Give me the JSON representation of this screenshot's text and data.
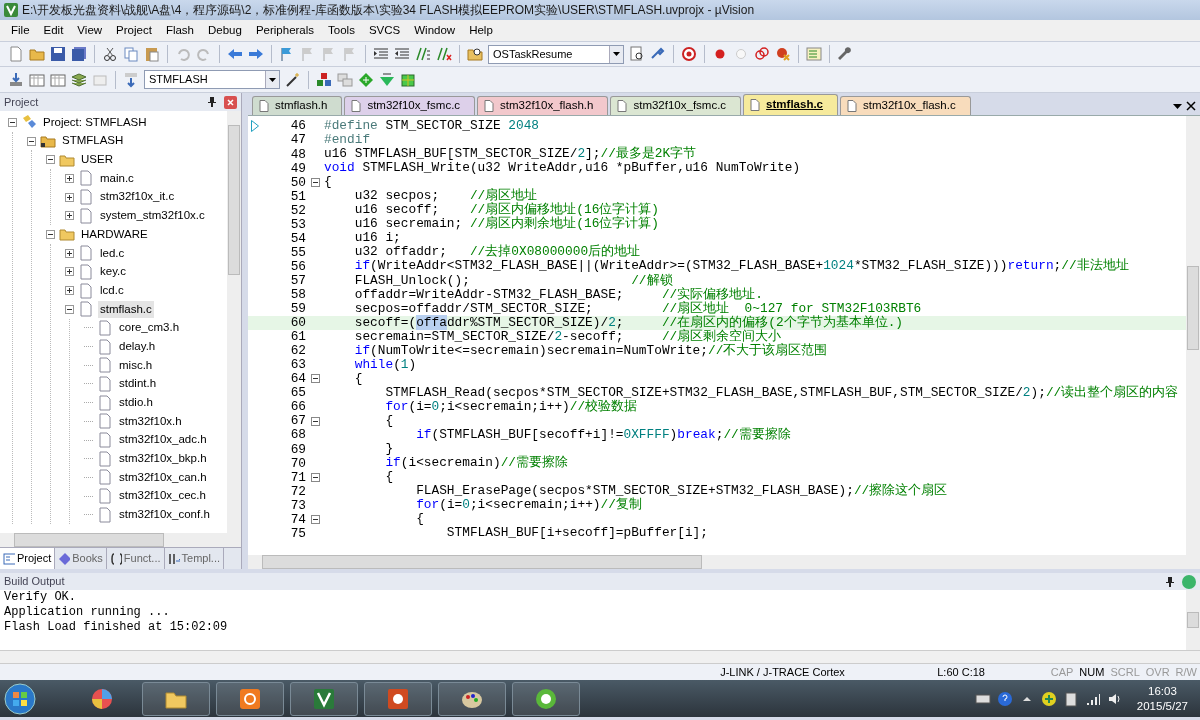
{
  "window": {
    "title": "E:\\开发板光盘资料\\战舰\\A盘\\4，程序源码\\2，标准例程-库函数版本\\实验34 FLASH模拟EEPROM实验\\USER\\STMFLASH.uvprojx - µVision"
  },
  "menu": [
    "File",
    "Edit",
    "View",
    "Project",
    "Flash",
    "Debug",
    "Peripherals",
    "Tools",
    "SVCS",
    "Window",
    "Help"
  ],
  "toolbar": {
    "function_combo": "OSTaskResume",
    "target_combo": "STMFLASH"
  },
  "project_panel": {
    "title": "Project",
    "tree": [
      {
        "label": "Project: STMFLASH",
        "kind": "project",
        "expanded": true,
        "selected": false,
        "children": [
          {
            "label": "STMFLASH",
            "kind": "group",
            "expanded": true,
            "selected": false,
            "children": [
              {
                "label": "USER",
                "kind": "folder",
                "expanded": true,
                "selected": false,
                "children": [
                  {
                    "label": "main.c",
                    "kind": "file",
                    "expanded": false,
                    "selected": false
                  },
                  {
                    "label": "stm32f10x_it.c",
                    "kind": "file",
                    "expanded": false,
                    "selected": false
                  },
                  {
                    "label": "system_stm32f10x.c",
                    "kind": "file",
                    "expanded": false,
                    "selected": false
                  }
                ]
              },
              {
                "label": "HARDWARE",
                "kind": "folder",
                "expanded": true,
                "selected": false,
                "children": [
                  {
                    "label": "led.c",
                    "kind": "file",
                    "expanded": false,
                    "selected": false
                  },
                  {
                    "label": "key.c",
                    "kind": "file",
                    "expanded": false,
                    "selected": false
                  },
                  {
                    "label": "lcd.c",
                    "kind": "file",
                    "expanded": false,
                    "selected": false
                  },
                  {
                    "label": "stmflash.c",
                    "kind": "file",
                    "expanded": true,
                    "selected": true,
                    "children": [
                      {
                        "label": "core_cm3.h",
                        "kind": "header",
                        "selected": false
                      },
                      {
                        "label": "delay.h",
                        "kind": "header",
                        "selected": false
                      },
                      {
                        "label": "misc.h",
                        "kind": "header",
                        "selected": false
                      },
                      {
                        "label": "stdint.h",
                        "kind": "header",
                        "selected": false
                      },
                      {
                        "label": "stdio.h",
                        "kind": "header",
                        "selected": false
                      },
                      {
                        "label": "stm32f10x.h",
                        "kind": "header",
                        "selected": false
                      },
                      {
                        "label": "stm32f10x_adc.h",
                        "kind": "header",
                        "selected": false
                      },
                      {
                        "label": "stm32f10x_bkp.h",
                        "kind": "header",
                        "selected": false
                      },
                      {
                        "label": "stm32f10x_can.h",
                        "kind": "header",
                        "selected": false
                      },
                      {
                        "label": "stm32f10x_cec.h",
                        "kind": "header",
                        "selected": false
                      },
                      {
                        "label": "stm32f10x_conf.h",
                        "kind": "header",
                        "selected": false
                      }
                    ]
                  }
                ]
              }
            ]
          }
        ]
      }
    ],
    "tabs": [
      {
        "label": "Project",
        "selected": true
      },
      {
        "label": "Books",
        "selected": false
      },
      {
        "label": "Funct...",
        "selected": false
      },
      {
        "label": "Templ...",
        "selected": false
      }
    ]
  },
  "editor": {
    "tabs": [
      {
        "label": "stmflash.h",
        "selected": false,
        "color": "#cfdccf"
      },
      {
        "label": "stm32f10x_fsmc.c",
        "selected": false,
        "color": "#ddd0ea"
      },
      {
        "label": "stm32f10x_flash.h",
        "selected": false,
        "color": "#f2c8cc"
      },
      {
        "label": "stm32f10x_fsmc.c",
        "selected": false,
        "color": "#dbe6d2"
      },
      {
        "label": "stmflash.c",
        "selected": true,
        "color": "#f6ea9c"
      },
      {
        "label": "stm32f10x_flash.c",
        "selected": false,
        "color": "#f8dcbc"
      }
    ],
    "lines": [
      {
        "number": "46",
        "fold_open": false,
        "marker": true,
        "current": false,
        "segments": [
          {
            "kind": "preproc",
            "text": "#define"
          },
          {
            "kind": "plain",
            "text": " STM_SECTOR_SIZE "
          },
          {
            "kind": "number",
            "text": "2048"
          }
        ]
      },
      {
        "number": "47",
        "fold_open": false,
        "marker": false,
        "current": false,
        "segments": [
          {
            "kind": "preproc",
            "text": "#endif"
          }
        ]
      },
      {
        "number": "48",
        "fold_open": false,
        "marker": false,
        "current": false,
        "segments": [
          {
            "kind": "plain",
            "text": "u16 STMFLASH_BUF[STM_SECTOR_SIZE/"
          },
          {
            "kind": "number",
            "text": "2"
          },
          {
            "kind": "plain",
            "text": "];"
          },
          {
            "kind": "comment",
            "text": "//最多是2K字节"
          }
        ]
      },
      {
        "number": "49",
        "fold_open": false,
        "marker": false,
        "current": false,
        "segments": [
          {
            "kind": "keyword",
            "text": "void"
          },
          {
            "kind": "plain",
            "text": " STMFLASH_Write(u32 WriteAddr,u16 *pBuffer,u16 NumToWrite)"
          }
        ]
      },
      {
        "number": "50",
        "fold_open": true,
        "marker": false,
        "current": false,
        "segments": [
          {
            "kind": "plain",
            "text": "{"
          }
        ]
      },
      {
        "number": "51",
        "fold_open": false,
        "marker": false,
        "current": false,
        "segments": [
          {
            "kind": "plain",
            "text": "    u32 secpos;    "
          },
          {
            "kind": "comment",
            "text": "//扇区地址"
          }
        ]
      },
      {
        "number": "52",
        "fold_open": false,
        "marker": false,
        "current": false,
        "segments": [
          {
            "kind": "plain",
            "text": "    u16 secoff;    "
          },
          {
            "kind": "comment",
            "text": "//扇区内偏移地址(16位字计算)"
          }
        ]
      },
      {
        "number": "53",
        "fold_open": false,
        "marker": false,
        "current": false,
        "segments": [
          {
            "kind": "plain",
            "text": "    u16 secremain; "
          },
          {
            "kind": "comment",
            "text": "//扇区内剩余地址(16位字计算)"
          }
        ]
      },
      {
        "number": "54",
        "fold_open": false,
        "marker": false,
        "current": false,
        "segments": [
          {
            "kind": "plain",
            "text": "    u16 i;"
          }
        ]
      },
      {
        "number": "55",
        "fold_open": false,
        "marker": false,
        "current": false,
        "segments": [
          {
            "kind": "plain",
            "text": "    u32 offaddr;   "
          },
          {
            "kind": "comment",
            "text": "//去掉0X08000000后的地址"
          }
        ]
      },
      {
        "number": "56",
        "fold_open": false,
        "marker": false,
        "current": false,
        "segments": [
          {
            "kind": "keyword",
            "text": "    if"
          },
          {
            "kind": "plain",
            "text": "(WriteAddr<STM32_FLASH_BASE||(WriteAddr>=(STM32_FLASH_BASE+"
          },
          {
            "kind": "number",
            "text": "1024"
          },
          {
            "kind": "plain",
            "text": "*STM32_FLASH_SIZE)))"
          },
          {
            "kind": "keyword",
            "text": "return"
          },
          {
            "kind": "plain",
            "text": ";"
          },
          {
            "kind": "comment",
            "text": "//非法地址"
          }
        ]
      },
      {
        "number": "57",
        "fold_open": false,
        "marker": false,
        "current": false,
        "segments": [
          {
            "kind": "plain",
            "text": "    FLASH_Unlock();                     "
          },
          {
            "kind": "comment",
            "text": "//解锁"
          }
        ]
      },
      {
        "number": "58",
        "fold_open": false,
        "marker": false,
        "current": false,
        "segments": [
          {
            "kind": "plain",
            "text": "    offaddr=WriteAddr-STM32_FLASH_BASE;     "
          },
          {
            "kind": "comment",
            "text": "//实际偏移地址."
          }
        ]
      },
      {
        "number": "59",
        "fold_open": false,
        "marker": false,
        "current": false,
        "segments": [
          {
            "kind": "plain",
            "text": "    secpos=offaddr/STM_SECTOR_SIZE;         "
          },
          {
            "kind": "comment",
            "text": "//扇区地址  0~127 for STM32F103RBT6"
          }
        ]
      },
      {
        "number": "60",
        "fold_open": false,
        "marker": false,
        "current": true,
        "segments": [
          {
            "kind": "plain",
            "text": "    secoff=("
          },
          {
            "kind": "selected",
            "text": "offa"
          },
          {
            "kind": "plain",
            "text": "ddr%STM_SECTOR_SIZE)/"
          },
          {
            "kind": "number",
            "text": "2"
          },
          {
            "kind": "plain",
            "text": ";     "
          },
          {
            "kind": "comment",
            "text": "//在扇区内的偏移(2个字节为基本单位.)"
          }
        ]
      },
      {
        "number": "61",
        "fold_open": false,
        "marker": false,
        "current": false,
        "segments": [
          {
            "kind": "plain",
            "text": "    secremain=STM_SECTOR_SIZE/"
          },
          {
            "kind": "number",
            "text": "2"
          },
          {
            "kind": "plain",
            "text": "-secoff;     "
          },
          {
            "kind": "comment",
            "text": "//扇区剩余空间大小"
          }
        ]
      },
      {
        "number": "62",
        "fold_open": false,
        "marker": false,
        "current": false,
        "segments": [
          {
            "kind": "keyword",
            "text": "    if"
          },
          {
            "kind": "plain",
            "text": "(NumToWrite<=secremain)secremain=NumToWrite;"
          },
          {
            "kind": "comment",
            "text": "//不大于该扇区范围"
          }
        ]
      },
      {
        "number": "63",
        "fold_open": false,
        "marker": false,
        "current": false,
        "segments": [
          {
            "kind": "keyword",
            "text": "    while"
          },
          {
            "kind": "plain",
            "text": "("
          },
          {
            "kind": "number",
            "text": "1"
          },
          {
            "kind": "plain",
            "text": ")"
          }
        ]
      },
      {
        "number": "64",
        "fold_open": true,
        "marker": false,
        "current": false,
        "segments": [
          {
            "kind": "plain",
            "text": "    {"
          }
        ]
      },
      {
        "number": "65",
        "fold_open": false,
        "marker": false,
        "current": false,
        "segments": [
          {
            "kind": "plain",
            "text": "        STMFLASH_Read(secpos*STM_SECTOR_SIZE+STM32_FLASH_BASE,STMFLASH_BUF,STM_SECTOR_SIZE/"
          },
          {
            "kind": "number",
            "text": "2"
          },
          {
            "kind": "plain",
            "text": ");"
          },
          {
            "kind": "comment",
            "text": "//读出整个扇区的内容"
          }
        ]
      },
      {
        "number": "66",
        "fold_open": false,
        "marker": false,
        "current": false,
        "segments": [
          {
            "kind": "keyword",
            "text": "        for"
          },
          {
            "kind": "plain",
            "text": "(i="
          },
          {
            "kind": "number",
            "text": "0"
          },
          {
            "kind": "plain",
            "text": ";i<secremain;i++)"
          },
          {
            "kind": "comment",
            "text": "//校验数据"
          }
        ]
      },
      {
        "number": "67",
        "fold_open": true,
        "marker": false,
        "current": false,
        "segments": [
          {
            "kind": "plain",
            "text": "        {"
          }
        ]
      },
      {
        "number": "68",
        "fold_open": false,
        "marker": false,
        "current": false,
        "segments": [
          {
            "kind": "keyword",
            "text": "            if"
          },
          {
            "kind": "plain",
            "text": "(STMFLASH_BUF[secoff+i]!="
          },
          {
            "kind": "number",
            "text": "0XFFFF"
          },
          {
            "kind": "plain",
            "text": ")"
          },
          {
            "kind": "keyword",
            "text": "break"
          },
          {
            "kind": "plain",
            "text": ";"
          },
          {
            "kind": "comment",
            "text": "//需要擦除"
          }
        ]
      },
      {
        "number": "69",
        "fold_open": false,
        "marker": false,
        "current": false,
        "segments": [
          {
            "kind": "plain",
            "text": "        }"
          }
        ]
      },
      {
        "number": "70",
        "fold_open": false,
        "marker": false,
        "current": false,
        "segments": [
          {
            "kind": "keyword",
            "text": "        if"
          },
          {
            "kind": "plain",
            "text": "(i<secremain)"
          },
          {
            "kind": "comment",
            "text": "//需要擦除"
          }
        ]
      },
      {
        "number": "71",
        "fold_open": true,
        "marker": false,
        "current": false,
        "segments": [
          {
            "kind": "plain",
            "text": "        {"
          }
        ]
      },
      {
        "number": "72",
        "fold_open": false,
        "marker": false,
        "current": false,
        "segments": [
          {
            "kind": "plain",
            "text": "            FLASH_ErasePage(secpos*STM_SECTOR_SIZE+STM32_FLASH_BASE);"
          },
          {
            "kind": "comment",
            "text": "//擦除这个扇区"
          }
        ]
      },
      {
        "number": "73",
        "fold_open": false,
        "marker": false,
        "current": false,
        "segments": [
          {
            "kind": "keyword",
            "text": "            for"
          },
          {
            "kind": "plain",
            "text": "(i="
          },
          {
            "kind": "number",
            "text": "0"
          },
          {
            "kind": "plain",
            "text": ";i<secremain;i++)"
          },
          {
            "kind": "comment",
            "text": "//复制"
          }
        ]
      },
      {
        "number": "74",
        "fold_open": true,
        "marker": false,
        "current": false,
        "segments": [
          {
            "kind": "plain",
            "text": "            {"
          }
        ]
      },
      {
        "number": "75",
        "fold_open": false,
        "marker": false,
        "current": false,
        "segments": [
          {
            "kind": "plain",
            "text": "                STMFLASH_BUF[i+secoff]=pBuffer[i];"
          }
        ]
      }
    ]
  },
  "build_output": {
    "title": "Build Output",
    "lines": [
      "Verify OK.",
      "Application running ...",
      "Flash Load finished at 15:02:09"
    ]
  },
  "status_bar": {
    "debugger": "J-LINK / J-TRACE Cortex",
    "position": "L:60 C:18",
    "indicators": [
      {
        "label": "CAP",
        "on": false
      },
      {
        "label": "NUM",
        "on": true
      },
      {
        "label": "SCRL",
        "on": false
      },
      {
        "label": "OVR",
        "on": false
      },
      {
        "label": "R/W",
        "on": false
      }
    ]
  },
  "taskbar": {
    "time": "16:03",
    "date": "2015/5/27"
  }
}
